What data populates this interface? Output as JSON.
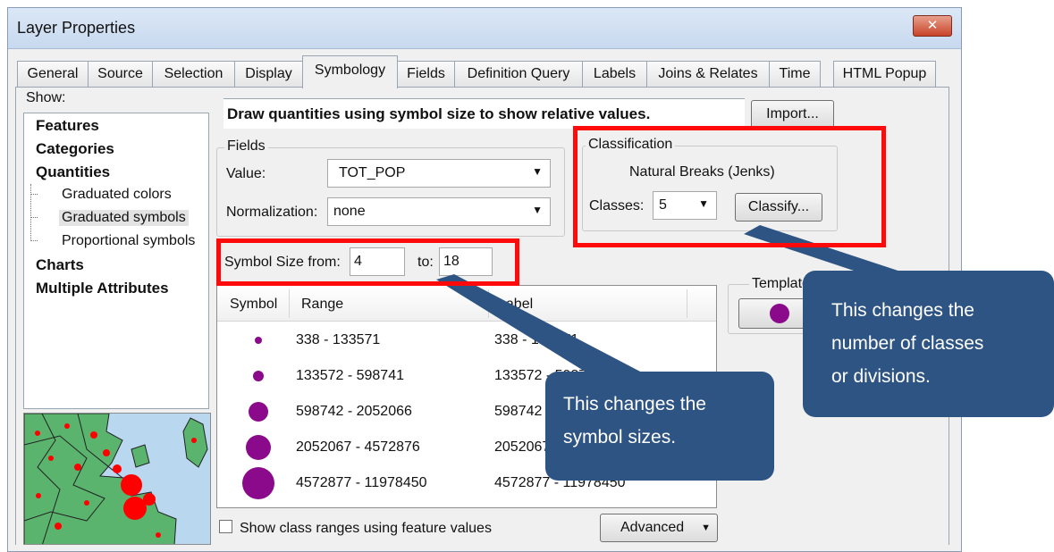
{
  "window": {
    "title": "Layer Properties",
    "close_glyph": "✕"
  },
  "tabs": [
    {
      "label": "General"
    },
    {
      "label": "Source"
    },
    {
      "label": "Selection"
    },
    {
      "label": "Display"
    },
    {
      "label": "Symbology",
      "active": true
    },
    {
      "label": "Fields"
    },
    {
      "label": "Definition Query"
    },
    {
      "label": "Labels"
    },
    {
      "label": "Joins & Relates"
    },
    {
      "label": "Time"
    },
    {
      "label": "HTML Popup"
    }
  ],
  "show": {
    "label": "Show:",
    "categories": [
      "Features",
      "Categories",
      "Quantities"
    ],
    "sub_items": [
      "Graduated colors",
      "Graduated symbols",
      "Proportional symbols"
    ],
    "selected_sub_item": "Graduated symbols",
    "more_categories": [
      "Charts",
      "Multiple Attributes"
    ]
  },
  "description": "Draw quantities using symbol size to show relative values.",
  "import_button": "Import...",
  "fields": {
    "title": "Fields",
    "value_label": "Value:",
    "value": "TOT_POP",
    "normalization_label": "Normalization:",
    "normalization": "none"
  },
  "classification": {
    "title": "Classification",
    "method": "Natural Breaks (Jenks)",
    "classes_label": "Classes:",
    "classes": "5",
    "classify_button": "Classify..."
  },
  "symbol_size": {
    "from_label": "Symbol Size from:",
    "from": "4",
    "to_label": "to:",
    "to": "18"
  },
  "table": {
    "headers": [
      "Symbol",
      "Range",
      "Label"
    ],
    "rows": [
      {
        "range": "338 - 133571",
        "label": "338 - 133571"
      },
      {
        "range": "133572 - 598741",
        "label": "133572 - 598741"
      },
      {
        "range": "598742 - 2052066",
        "label": "598742 - 2052066"
      },
      {
        "range": "2052067 - 4572876",
        "label": "2052067 - 4572876"
      },
      {
        "range": "4572877 - 11978450",
        "label": "4572877 - 11978450"
      }
    ],
    "symbol_color": "#8b0a8b"
  },
  "template_label": "Template",
  "show_ranges_checkbox": {
    "label": "Show class ranges using feature values",
    "checked": false
  },
  "advanced_button": "Advanced",
  "callouts": {
    "classes_line1": "This changes the",
    "classes_line2": "number of classes",
    "classes_line3": "or divisions.",
    "sizes_line1": "This changes the",
    "sizes_line2": "symbol sizes."
  },
  "colors": {
    "highlight": "#ff0a0a",
    "callout": "#2e5484",
    "map_land": "#5ab46e",
    "map_water": "#b9d7ef",
    "map_points": "#ff0000"
  }
}
